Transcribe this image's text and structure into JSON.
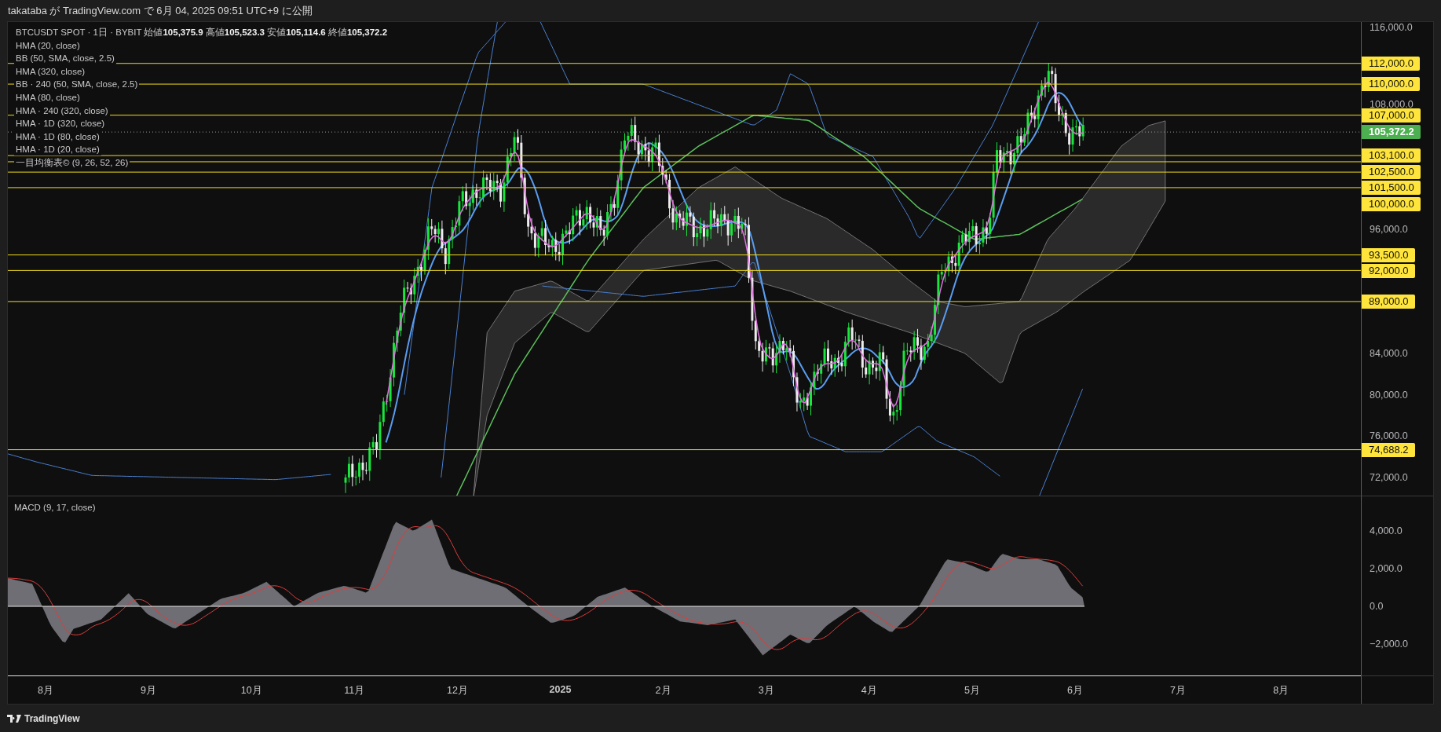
{
  "header": {
    "text": "takataba が TradingView.com で 6月 04, 2025 09:51 UTC+9 に公開"
  },
  "chart": {
    "legend": {
      "symbol_line": "BTCUSDT SPOT · 1日 · BYBIT  始値**105,375.9**  高値**105,523.3**  安値**105,114.6**  終値**105,372.2**",
      "indicators": [
        "HMA (20, close)",
        "BB (50, SMA, close, 2.5)",
        "HMA (320, close)",
        "BB · 240 (50, SMA, close, 2.5)",
        "HMA (80, close)",
        "HMA · 240 (320, close)",
        "HMA · 1D (320, close)",
        "HMA · 1D (80, close)",
        "HMA · 1D (20, close)",
        "一目均衡表© (9, 26, 52, 26)"
      ]
    },
    "price_axis": {
      "ticks": [
        "116,000.0",
        "108,000.0",
        "96,000.0",
        "84,000.0",
        "80,000.0",
        "76,000.0",
        "72,000.0"
      ]
    },
    "price_lines": [
      {
        "label": "112,000.0"
      },
      {
        "label": "110,000.0"
      },
      {
        "label": "107,000.0"
      },
      {
        "label": "103,100.0"
      },
      {
        "label": "102,500.0"
      },
      {
        "label": "101,500.0"
      },
      {
        "label": "100,000.0"
      },
      {
        "label": "93,500.0"
      },
      {
        "label": "92,000.0"
      },
      {
        "label": "89,000.0"
      },
      {
        "label": "74,688.2"
      }
    ],
    "current_price": {
      "label": "105,372.2"
    },
    "macd": {
      "title": "MACD (9, 17, close)",
      "ticks": [
        "4,000.0",
        "2,000.0",
        "0.0",
        "−2,000.0"
      ]
    },
    "time_axis": [
      {
        "label": "8月",
        "kind": "month"
      },
      {
        "label": "9月",
        "kind": "month"
      },
      {
        "label": "10月",
        "kind": "month"
      },
      {
        "label": "11月",
        "kind": "month"
      },
      {
        "label": "12月",
        "kind": "month"
      },
      {
        "label": "2025",
        "kind": "year"
      },
      {
        "label": "2月",
        "kind": "month"
      },
      {
        "label": "3月",
        "kind": "month"
      },
      {
        "label": "4月",
        "kind": "month"
      },
      {
        "label": "5月",
        "kind": "month"
      },
      {
        "label": "6月",
        "kind": "month"
      },
      {
        "label": "7月",
        "kind": "month"
      },
      {
        "label": "8月",
        "kind": "month"
      }
    ]
  },
  "footer": {
    "brand": "TradingView"
  }
}
